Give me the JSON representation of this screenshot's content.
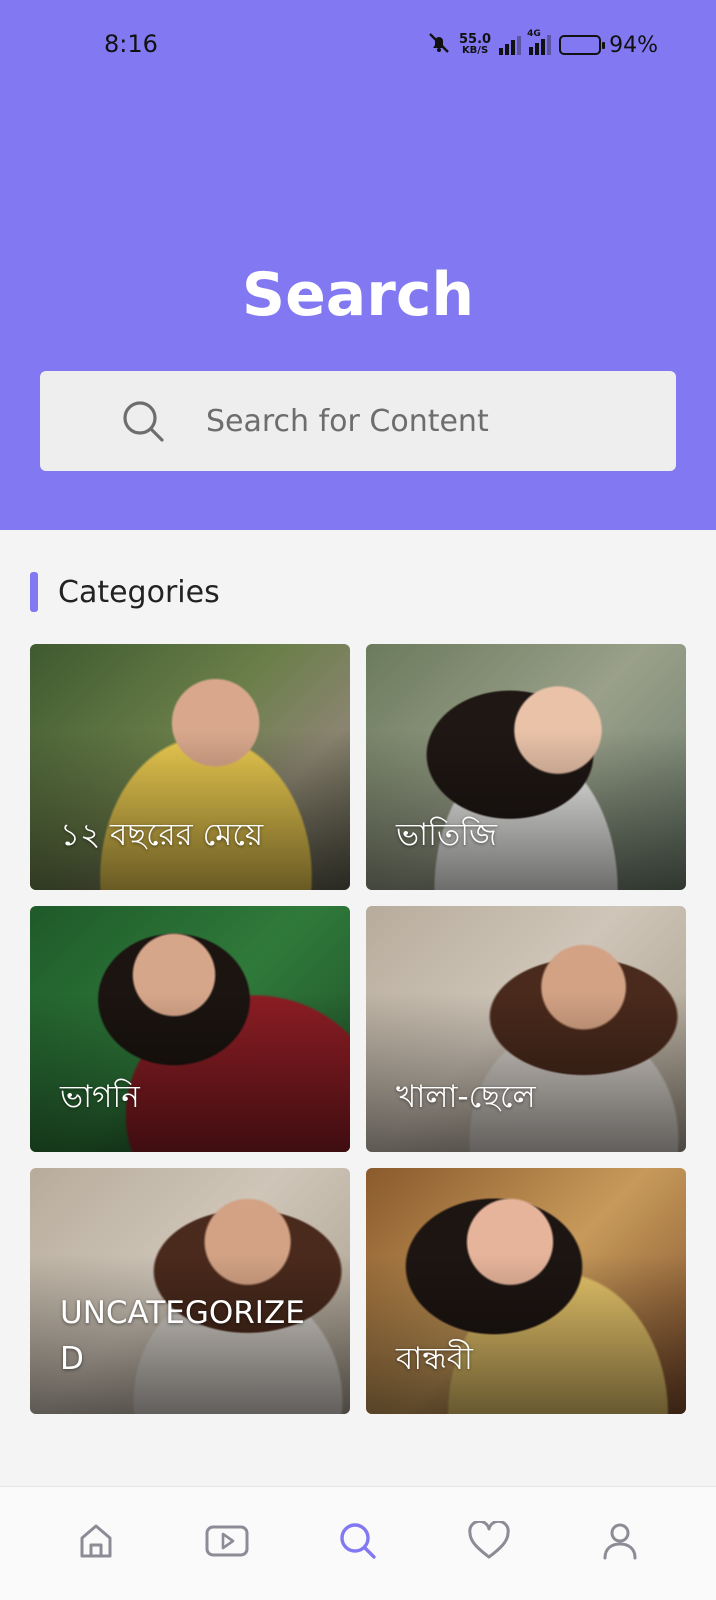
{
  "status_bar": {
    "time": "8:16",
    "net_speed_value": "55.0",
    "net_speed_unit": "KB/S",
    "network_type": "4G",
    "battery_percent": "94%",
    "icons": [
      "mute-bell-icon",
      "signal-icon",
      "4g-signal-icon",
      "battery-icon"
    ]
  },
  "header": {
    "title": "Search",
    "background_color": "#8279f2"
  },
  "search": {
    "placeholder": "Search for Content",
    "value": "",
    "icon": "search-icon"
  },
  "categories": {
    "heading": "Categories",
    "accent_color": "#8279f2",
    "items": [
      {
        "label": "১২ বছরের মেয়ে",
        "image": "category-photo"
      },
      {
        "label": "ভাতিজি",
        "image": "category-photo"
      },
      {
        "label": "ভাগনি",
        "image": "category-photo"
      },
      {
        "label": "খালা-ছেলে",
        "image": "category-photo"
      },
      {
        "label": "UNCATEGORIZED",
        "image": "category-photo"
      },
      {
        "label": "বান্ধবী",
        "image": "category-photo"
      }
    ]
  },
  "bottom_nav": {
    "items": [
      {
        "name": "home",
        "icon": "home-icon",
        "active": false
      },
      {
        "name": "videos",
        "icon": "play-icon",
        "active": false
      },
      {
        "name": "search",
        "icon": "search-icon",
        "active": true
      },
      {
        "name": "favorites",
        "icon": "heart-icon",
        "active": false
      },
      {
        "name": "profile",
        "icon": "user-icon",
        "active": false
      }
    ],
    "active_color": "#8279f2",
    "inactive_color": "#8c8c96"
  }
}
